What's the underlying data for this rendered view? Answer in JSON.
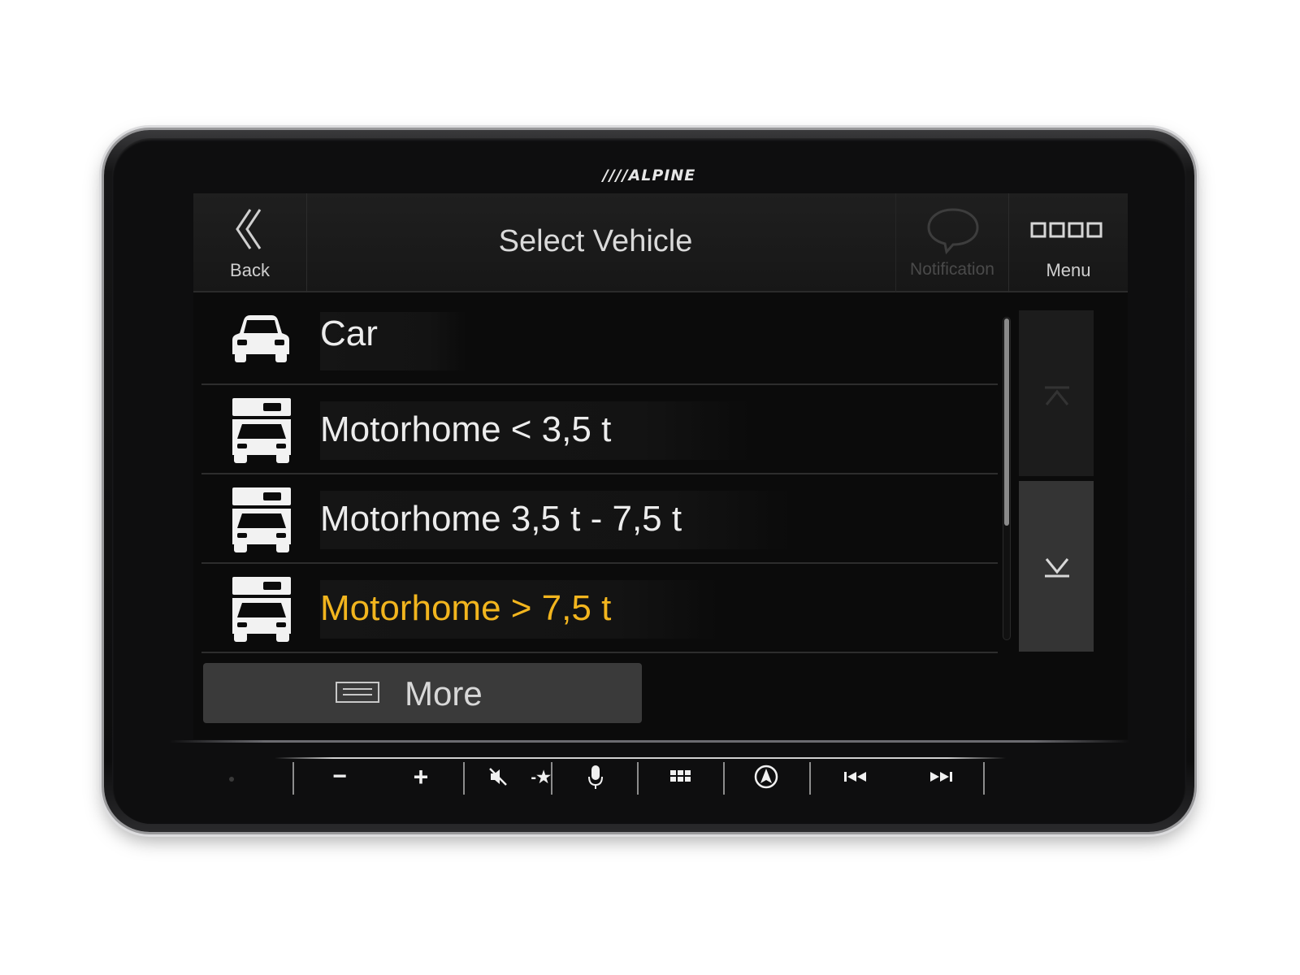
{
  "device": {
    "brand": "////ALPINE"
  },
  "header": {
    "back_label": "Back",
    "title": "Select Vehicle",
    "notification_label": "Notification",
    "menu_label": "Menu"
  },
  "list": {
    "items": [
      {
        "label": "Car",
        "icon": "car-icon",
        "selected": false
      },
      {
        "label": "Motorhome < 3,5 t",
        "icon": "motorhome-icon",
        "selected": false
      },
      {
        "label": "Motorhome 3,5 t - 7,5 t",
        "icon": "motorhome-icon",
        "selected": false
      },
      {
        "label": "Motorhome > 7,5 t",
        "icon": "motorhome-icon",
        "selected": true
      }
    ],
    "selected_color": "#f2b51e"
  },
  "more": {
    "label": "More"
  },
  "hardware_buttons": {
    "minus": "−",
    "plus": "+",
    "mute_favorite": "-★"
  }
}
